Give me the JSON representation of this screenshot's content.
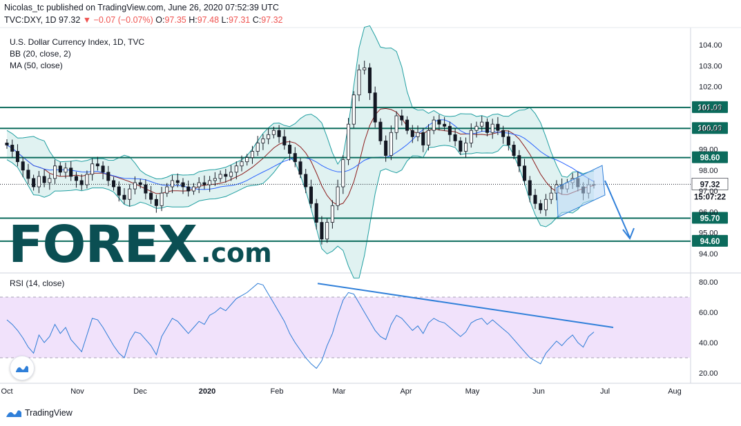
{
  "header": {
    "publisher_line": "Nicolas_tc published on TradingView.com, June 26, 2020 07:52:39 UTC",
    "symbol": "TVC:DXY, 1D",
    "last": "97.32",
    "arrow": "▼",
    "change": "−0.07 (−0.07%)",
    "o_label": "O:",
    "o_value": "97.35",
    "h_label": "H:",
    "h_value": "97.48",
    "l_label": "L:",
    "l_value": "97.31",
    "c_label": "C:",
    "c_value": "97.32"
  },
  "legend": {
    "title": "U.S. Dollar Currency Index, 1D, TVC",
    "bb": "BB (20, close, 2)",
    "ma": "MA (50, close)",
    "rsi": "RSI (14, close)"
  },
  "watermark": {
    "main": "FOREX",
    "suffix": ".com"
  },
  "footer": {
    "brand": "TradingView"
  },
  "colors": {
    "level_line": "#0b6b5c",
    "level_label_bg": "#0b6b5c",
    "price_label_bg": "#131722",
    "trend": "#2f7fd9",
    "candle": "#131722",
    "bb_band": "#1e9ea0",
    "bb_fill": "#d8efee",
    "ma_line": "#2962ff",
    "basis_line": "#8b1a1a",
    "rsi_line": "#2b7bd6",
    "rsi_band": "#f1e2fb"
  },
  "chart_data": [
    {
      "type": "candlestick",
      "title": "U.S. Dollar Currency Index, 1D, TVC",
      "ylim": [
        93.4,
        104.6
      ],
      "y_ticks": [
        "104.00",
        "103.00",
        "102.00",
        "101.00",
        "100.00",
        "99.00",
        "98.00",
        "97.00",
        "96.00",
        "95.00",
        "94.00"
      ],
      "x_ticks": [
        "Oct",
        "Nov",
        "Dec",
        "2020",
        "Feb",
        "Mar",
        "Apr",
        "May",
        "Jun",
        "Jul",
        "Aug"
      ],
      "levels": [
        "101.00",
        "100.00",
        "98.60",
        "95.70",
        "94.60"
      ],
      "level_values": [
        101.0,
        100.0,
        98.6,
        95.7,
        94.6
      ],
      "last_price": 97.32,
      "last_price_label": "97.32",
      "countdown": "15:07:22",
      "close_series": [
        99.2,
        98.9,
        98.4,
        98.0,
        97.6,
        97.2,
        97.7,
        97.4,
        97.6,
        98.2,
        97.9,
        98.1,
        97.7,
        97.5,
        97.3,
        97.8,
        98.3,
        98.2,
        97.9,
        97.5,
        97.2,
        96.8,
        96.6,
        97.1,
        97.4,
        97.3,
        96.9,
        96.6,
        96.3,
        96.9,
        97.2,
        97.5,
        97.4,
        97.2,
        97.0,
        97.2,
        97.4,
        97.3,
        97.5,
        97.6,
        97.8,
        97.7,
        97.9,
        98.2,
        98.4,
        98.6,
        98.9,
        99.3,
        99.5,
        99.7,
        99.9,
        99.6,
        99.2,
        98.8,
        98.4,
        97.8,
        97.2,
        96.4,
        95.5,
        94.7,
        95.5,
        96.3,
        97.2,
        98.5,
        100.2,
        101.6,
        102.8,
        102.9,
        101.7,
        100.3,
        99.4,
        98.7,
        99.8,
        100.6,
        100.4,
        99.9,
        99.6,
        99.8,
        99.2,
        99.9,
        100.4,
        100.2,
        100.1,
        99.7,
        99.4,
        98.9,
        99.3,
        99.9,
        100.1,
        100.3,
        99.8,
        100.2,
        99.9,
        99.6,
        99.2,
        98.7,
        98.2,
        97.5,
        96.8,
        96.4,
        96.1,
        96.6,
        96.9,
        97.3,
        97.1,
        97.4,
        97.6,
        97.2,
        96.9,
        97.3,
        97.32
      ]
    },
    {
      "type": "line",
      "title": "RSI (14, close)",
      "ylim": [
        18,
        85
      ],
      "y_ticks": [
        "80.00",
        "60.00",
        "40.00",
        "20.00"
      ],
      "band": [
        30,
        70
      ],
      "values": [
        55,
        52,
        48,
        43,
        37,
        33,
        45,
        40,
        44,
        52,
        46,
        50,
        42,
        38,
        34,
        45,
        56,
        55,
        50,
        44,
        38,
        33,
        30,
        41,
        47,
        46,
        42,
        38,
        32,
        44,
        50,
        56,
        54,
        50,
        46,
        50,
        54,
        52,
        58,
        60,
        63,
        61,
        65,
        69,
        71,
        73,
        76,
        79,
        78,
        72,
        66,
        60,
        54,
        46,
        40,
        35,
        30,
        26,
        23,
        28,
        38,
        46,
        58,
        68,
        73,
        72,
        66,
        60,
        54,
        48,
        44,
        42,
        52,
        58,
        56,
        52,
        48,
        51,
        46,
        53,
        56,
        54,
        53,
        50,
        47,
        44,
        47,
        53,
        55,
        56,
        52,
        55,
        52,
        49,
        46,
        42,
        38,
        34,
        30,
        28,
        26,
        33,
        37,
        41,
        38,
        42,
        45,
        40,
        37,
        44,
        47
      ],
      "trend_start_value": 79,
      "trend_end_value": 50
    }
  ]
}
